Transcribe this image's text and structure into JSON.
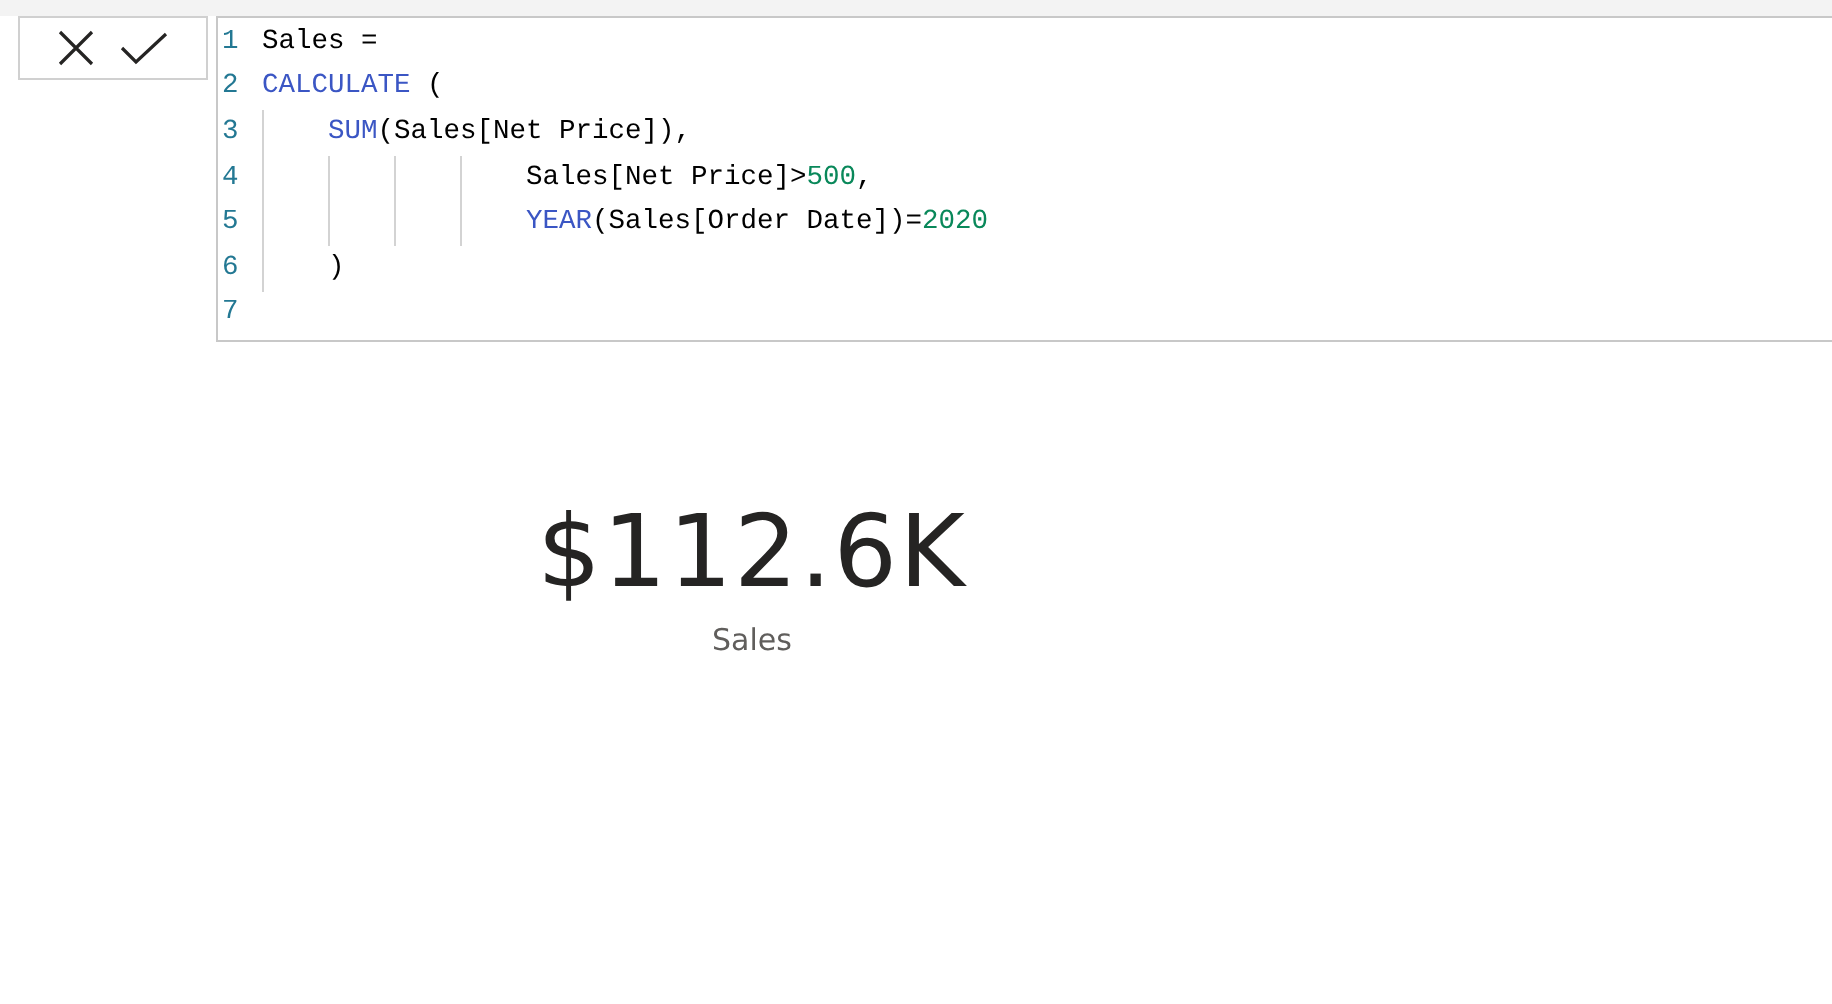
{
  "formula_bar": {
    "buttons": [
      {
        "kind": "cancel"
      },
      {
        "kind": "commit"
      }
    ],
    "lines": [
      {
        "number": "1",
        "tokens": [
          {
            "kind": "plain",
            "text": "Sales ="
          }
        ]
      },
      {
        "number": "2",
        "tokens": [
          {
            "kind": "function",
            "text": "CALCULATE"
          },
          {
            "kind": "plain",
            "text": " ("
          }
        ]
      },
      {
        "number": "3",
        "tokens": [
          {
            "kind": "function",
            "text": "    SUM"
          },
          {
            "kind": "plain",
            "text": "(Sales[Net Price]),"
          }
        ]
      },
      {
        "number": "4",
        "tokens": [
          {
            "kind": "plain",
            "text": "                Sales[Net Price]>"
          },
          {
            "kind": "number",
            "text": "500"
          },
          {
            "kind": "plain",
            "text": ","
          }
        ]
      },
      {
        "number": "5",
        "tokens": [
          {
            "kind": "function",
            "text": "                YEAR"
          },
          {
            "kind": "plain",
            "text": "(Sales[Order Date])="
          },
          {
            "kind": "number",
            "text": "2020"
          }
        ]
      },
      {
        "number": "6",
        "tokens": [
          {
            "kind": "plain",
            "text": "    )"
          }
        ]
      },
      {
        "number": "7"
      }
    ]
  },
  "card": {
    "value": "$112.6K",
    "label": "Sales"
  }
}
